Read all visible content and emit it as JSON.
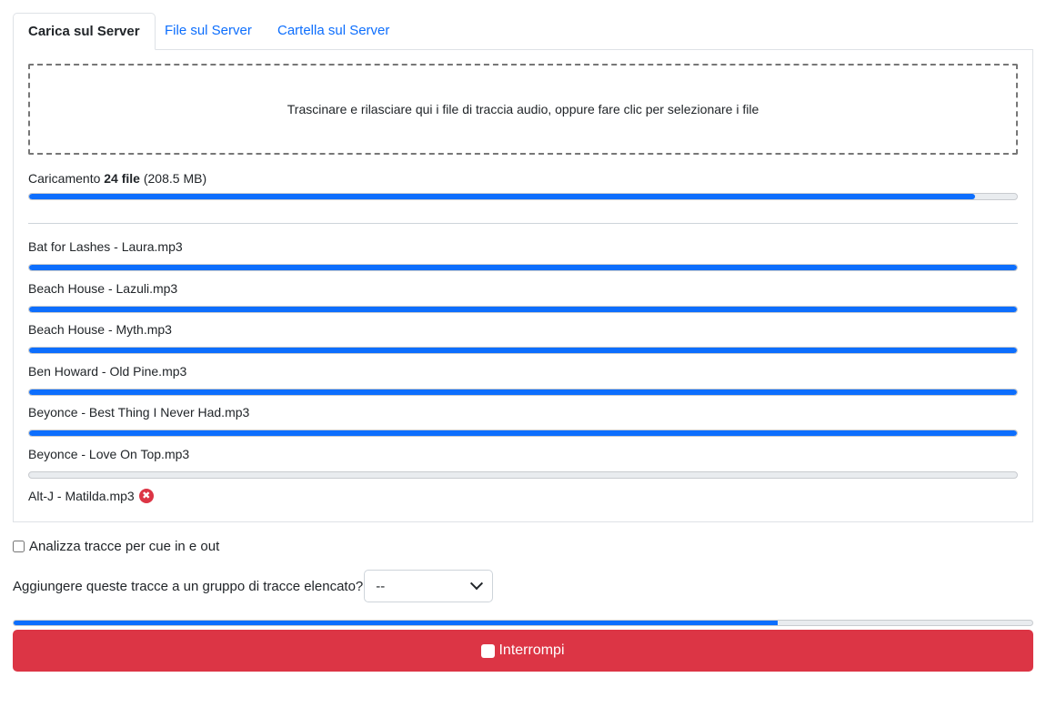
{
  "tabs": [
    {
      "label": "Carica sul Server",
      "active": true
    },
    {
      "label": "File sul Server",
      "active": false
    },
    {
      "label": "Cartella sul Server",
      "active": false
    }
  ],
  "dropzone": {
    "text": "Trascinare e rilasciare qui i file di traccia audio, oppure fare clic per selezionare i file"
  },
  "overall": {
    "prefix": "Caricamento",
    "count": "24 file",
    "size": "(208.5 MB)",
    "progress": 0.958
  },
  "files": [
    {
      "name": "Bat for Lashes - Laura.mp3",
      "progress": 1.0
    },
    {
      "name": "Beach House - Lazuli.mp3",
      "progress": 1.0
    },
    {
      "name": "Beach House - Myth.mp3",
      "progress": 1.0
    },
    {
      "name": "Ben Howard - Old Pine.mp3",
      "progress": 1.0
    },
    {
      "name": "Beyonce - Best Thing I Never Had.mp3",
      "progress": 1.0
    },
    {
      "name": "Beyonce - Love On Top.mp3",
      "progress": 0.0
    },
    {
      "name": "Alt-J - Matilda.mp3",
      "error": true,
      "error_icon": "error-x-icon"
    }
  ],
  "options": {
    "analyze_label": "Analizza tracce per cue in e out",
    "analyze_checked": false,
    "group_label": "Aggiungere queste tracce a un gruppo di tracce elencato?",
    "group_selected": "--"
  },
  "main_progress": 0.75,
  "stop_button": {
    "label": "Interrompi"
  },
  "colors": {
    "accent": "#0d6efd",
    "danger": "#dc3545"
  }
}
